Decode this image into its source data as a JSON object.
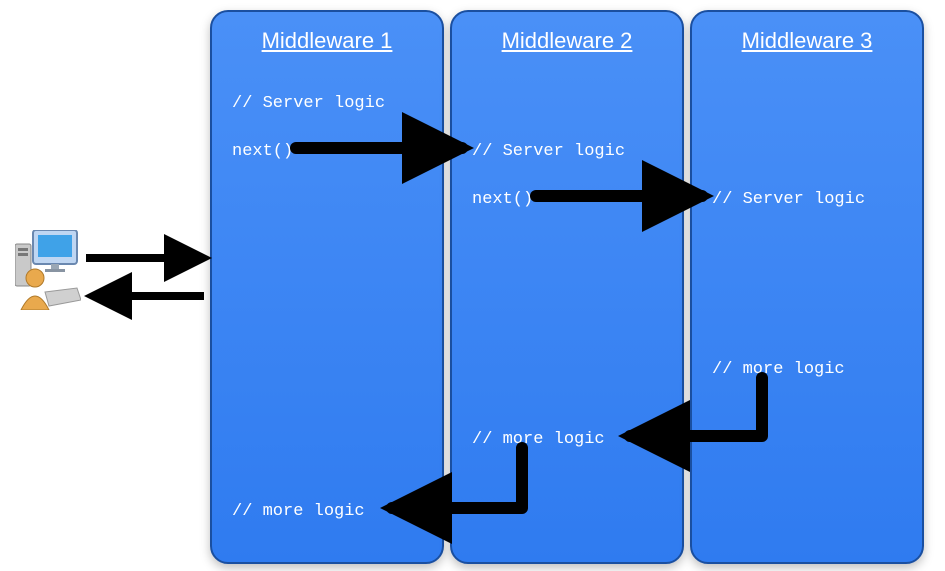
{
  "middleware": [
    {
      "title": "Middleware 1",
      "server_logic": "// Server logic",
      "next_call": "next()",
      "more_logic": "// more logic"
    },
    {
      "title": "Middleware 2",
      "server_logic": "// Server logic",
      "next_call": "next()",
      "more_logic": "// more logic"
    },
    {
      "title": "Middleware 3",
      "server_logic": "// Server logic",
      "more_logic": "// more logic"
    }
  ]
}
